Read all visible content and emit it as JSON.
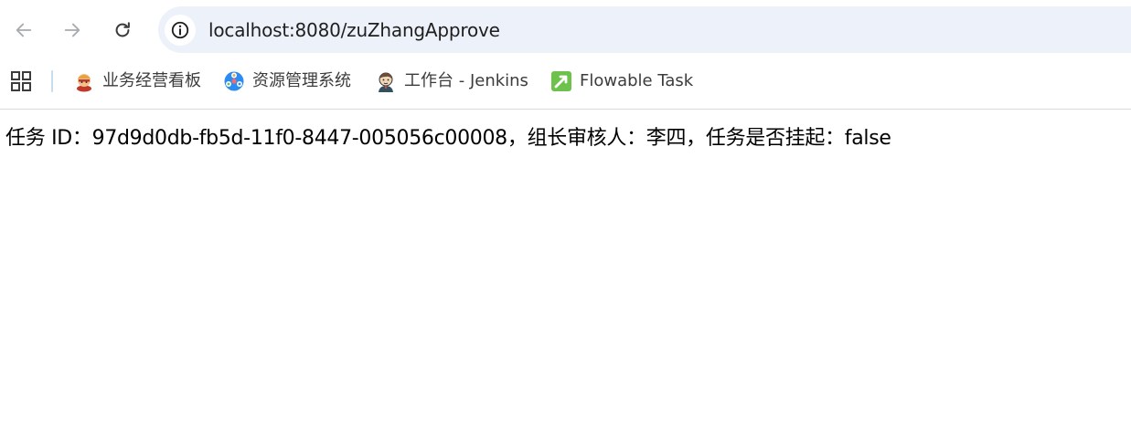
{
  "browser": {
    "address_bar": {
      "url": "localhost:8080/zuZhangApprove",
      "site_info_icon": "info-icon"
    },
    "nav": {
      "back_icon": "arrow-left-icon",
      "forward_icon": "arrow-right-icon",
      "reload_icon": "reload-icon"
    },
    "bookmarks": {
      "apps_icon": "apps-grid-icon",
      "items": [
        {
          "label": "业务经营看板",
          "icon": "bookmark-dashboard-icon"
        },
        {
          "label": "资源管理系统",
          "icon": "bookmark-resource-icon"
        },
        {
          "label": "工作台 - Jenkins",
          "icon": "jenkins-icon"
        },
        {
          "label": "Flowable Task",
          "icon": "flowable-icon"
        }
      ]
    }
  },
  "content": {
    "task_line": "任务 ID：97d9d0db-fb5d-11f0-8447-005056c00008，组长审核人：李四，任务是否挂起：false"
  },
  "colors": {
    "omnibox_bg": "#edf1f9",
    "icon_gray": "#5f6368",
    "text": "#1f1f1f",
    "flowable_green": "#6cc24a"
  }
}
